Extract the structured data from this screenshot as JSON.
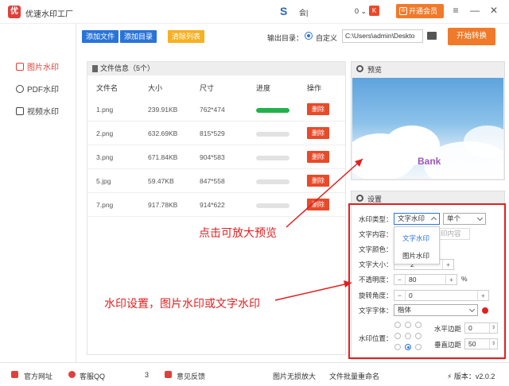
{
  "app": {
    "title": "优速水印工厂",
    "logo": "优"
  },
  "user": {
    "name": "会|",
    "coins": "0",
    "vip_label": "开通会员"
  },
  "sidebar": {
    "items": [
      {
        "label": "图片水印",
        "active": true
      },
      {
        "label": "PDF水印",
        "active": false
      },
      {
        "label": "视频水印",
        "active": false
      }
    ]
  },
  "toolbar": {
    "add_file": "添加文件",
    "add_dir": "添加目录",
    "clear_list": "清除列表",
    "output_label": "输出目录：",
    "radio_label": "自定义",
    "output_path": "C:\\Users\\admin\\Deskto",
    "start": "开始转换",
    "colors": {
      "blue": "#2a74d8",
      "orange": "#f7b020",
      "accent": "#f07a2a"
    }
  },
  "file_panel": {
    "header": "文件信息（5个）",
    "columns": [
      "文件名",
      "大小",
      "尺寸",
      "进度",
      "操作"
    ],
    "rows": [
      {
        "name": "1.png",
        "size": "239.91KB",
        "dim": "762*474",
        "progress": 1.0,
        "action": "删除"
      },
      {
        "name": "2.png",
        "size": "632.69KB",
        "dim": "815*529",
        "progress": 0.0,
        "action": "删除"
      },
      {
        "name": "3.png",
        "size": "671.84KB",
        "dim": "904*583",
        "progress": 0.0,
        "action": "删除"
      },
      {
        "name": "5.jpg",
        "size": "59.47KB",
        "dim": "847*558",
        "progress": 0.0,
        "action": "删除"
      },
      {
        "name": "7.png",
        "size": "917.78KB",
        "dim": "914*622",
        "progress": 0.0,
        "action": "删除"
      }
    ]
  },
  "preview": {
    "title": "预览",
    "watermark_text": "Bank"
  },
  "settings": {
    "title": "设置",
    "type_label": "水印类型：",
    "type_value": "文字水印",
    "mode_value": "单个",
    "content_label": "文字内容：",
    "content_placeholder": "印内容",
    "color_label": "文字颜色：",
    "size_label": "文字大小：",
    "size_value": "2",
    "dropdown_options": [
      "文字水印",
      "图片水印"
    ],
    "opacity_label": "不透明度：",
    "opacity_value": "80",
    "opacity_unit": "%",
    "rotate_label": "旋转角度：",
    "rotate_value": "0",
    "font_label": "文字字体：",
    "font_value": "楷体",
    "position_label": "水印位置：",
    "h_margin_label": "水平边距",
    "h_margin_value": "0",
    "v_margin_label": "垂直边距",
    "v_margin_value": "50"
  },
  "annotations": {
    "preview_hint": "点击可放大预览",
    "settings_hint": "水印设置，图片水印或文字水印"
  },
  "footer": {
    "site": "官方网址",
    "service": "客服QQ",
    "service_number": "3",
    "feedback": "意见反馈",
    "link1": "图片无损放大",
    "link2": "文件批量重命名",
    "version": "版本：v2.0.2"
  }
}
